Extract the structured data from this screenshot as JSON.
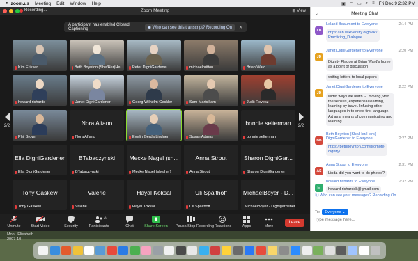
{
  "menubar": {
    "app": "zoom.us",
    "items": [
      "Meeting",
      "Edit",
      "Window",
      "Help"
    ],
    "datetime": "Fri Dec 9  2:32 PM"
  },
  "window": {
    "title": "Zoom Meeting",
    "recording": "Recording...",
    "view": "View",
    "cc_banner": "A participant has enabled Closed Captioning",
    "cc_question": "Who can see this transcript? Recording On"
  },
  "nav": {
    "page_left": "2/2",
    "page_right": "2/2"
  },
  "participants": [
    {
      "name": "Kim Eriksen",
      "kind": "video"
    },
    {
      "name": "Beth Boynton (She/Her)He...",
      "kind": "video"
    },
    {
      "name": "Peter DigniGardener",
      "kind": "video"
    },
    {
      "name": "michaelbritton",
      "kind": "video"
    },
    {
      "name": "Brian Ward",
      "kind": "video"
    },
    {
      "name": "howard richards",
      "kind": "video"
    },
    {
      "name": "Janet DigniGardener",
      "kind": "video"
    },
    {
      "name": "Georg-Wilhelm Geckler",
      "kind": "video"
    },
    {
      "name": "Sam Maricikam",
      "kind": "video"
    },
    {
      "name": "Judit Revesz",
      "kind": "video"
    },
    {
      "name": "Phil Brown",
      "kind": "video"
    },
    {
      "name": "Nora Alfano",
      "big": "Nora Alfano",
      "kind": "text"
    },
    {
      "name": "Evelin Gerda Lindner",
      "kind": "video"
    },
    {
      "name": "Susan Adams",
      "kind": "video"
    },
    {
      "name": "bonnie selterman",
      "big": "bonnie selterman",
      "kind": "text"
    },
    {
      "name": "Ella DigniGardener",
      "big": "Ella DigniGardener",
      "kind": "text"
    },
    {
      "name": "BTabaczynski",
      "big": "BTabaczynski",
      "kind": "text"
    },
    {
      "name": "Mecke Nagel (she/her)",
      "big": "Mecke Nagel (sh...",
      "kind": "text"
    },
    {
      "name": "Anna Strout",
      "big": "Anna Strout",
      "kind": "text"
    },
    {
      "name": "Sharon DigniGardener",
      "big": "Sharon DigniGar...",
      "kind": "text"
    },
    {
      "name": "Tony Gaskew",
      "big": "Tony Gaskew",
      "kind": "text"
    },
    {
      "name": "Valerie",
      "big": "Valerie",
      "kind": "text"
    },
    {
      "name": "Hayal Köksal",
      "big": "Hayal Köksal",
      "kind": "text"
    },
    {
      "name": "Uli Spalthoff",
      "big": "Uli Spalthoff",
      "kind": "text"
    },
    {
      "name": "MichaelBoyer - Dignigardener",
      "big": "MichaelBoyer - D...",
      "kind": "text"
    }
  ],
  "toolbar": {
    "unmute": "Unmute",
    "start_video": "Start Video",
    "security": "Security",
    "participants": "Participants",
    "participants_count": "37",
    "chat": "Chat",
    "share": "Share Screen",
    "record": "Pause/Stop Recording",
    "reactions": "Reactions",
    "apps": "Apps",
    "more": "More",
    "leave": "Leave"
  },
  "chat": {
    "title": "Meeting Chat",
    "messages": [
      {
        "avatar": "LB",
        "color": "#8e57c8",
        "from": "Leland Beaumont to Everyone",
        "time": "2:14 PM",
        "text": "https://en.wikiversity.org/wiki/\nPracticing_Dialogue"
      },
      {
        "avatar": "JD",
        "color": "#e6a21f",
        "from": "Janet DigniGardener to Everyone",
        "time": "2:20 PM",
        "text": "Dignity Plaque at Brian Ward's home\nas a point of discussion"
      },
      {
        "avatar": "",
        "color": "",
        "from": "",
        "time": "",
        "text": "writing letters to local papers"
      },
      {
        "avatar": "JD",
        "color": "#e6a21f",
        "from": "Janet DigniGardener to Everyone",
        "time": "2:22 PM",
        "text": "wider ways we learn --  moving, with\nthe senses, experiential learning,\nlearning by travel. Infusing other\nlanguages in to one's first language.\nArt as a means of communicating and\nlearning"
      },
      {
        "avatar": "BB",
        "color": "#d4483b",
        "from": "Beth Boynton (She/Her/Hers)\nDigniGardener to Everyone",
        "time": "2:27 PM",
        "text": "https://bethboynton.com/promote-\ndignity/"
      },
      {
        "avatar": "AS",
        "color": "#d4483b",
        "from": "Anna Strout to Everyone",
        "time": "2:31 PM",
        "text": "Linda-did you want to do photos?"
      },
      {
        "avatar": "hr",
        "color": "#2fae6e",
        "from": "howard richards to Everyone",
        "time": "2:32 PM",
        "text": "howard.richards8@gmail.com"
      }
    ],
    "who_can_see": "Who can see your messages? Recording On",
    "to_label": "To:",
    "to_value": "Everyone",
    "placeholder": "Type message here..."
  },
  "desktop": {
    "file_lines": [
      "Mon...Elisabeth",
      "2007-10"
    ]
  }
}
